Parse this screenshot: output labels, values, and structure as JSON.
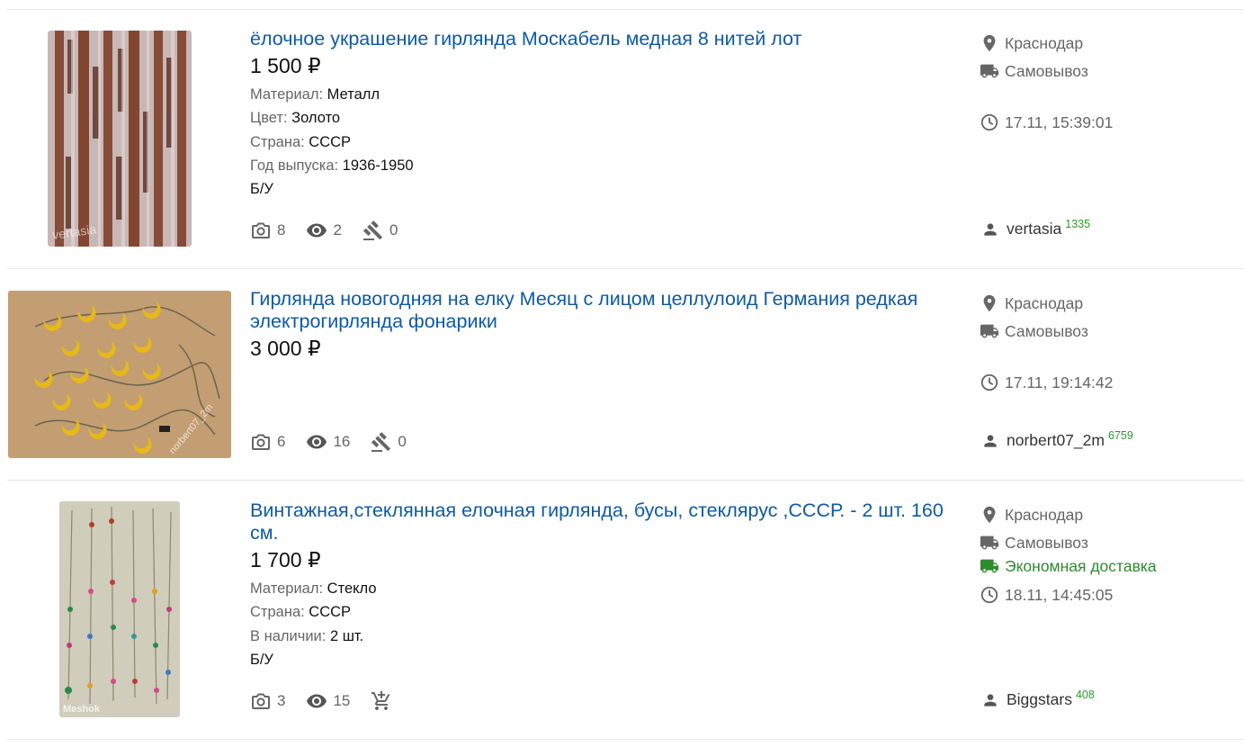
{
  "listings": [
    {
      "title": "ёлочное украшение гирлянда Москабель медная 8 нитей лот",
      "price": "1 500 ₽",
      "attributes": [
        {
          "key": "Материал:",
          "value": "Металл"
        },
        {
          "key": "Цвет:",
          "value": "Золото"
        },
        {
          "key": "Страна:",
          "value": "СССР"
        },
        {
          "key": "Год выпуска:",
          "value": "1936-1950"
        }
      ],
      "condition": "Б/У",
      "photos": "8",
      "views": "2",
      "bids": "0",
      "city": "Краснодар",
      "pickup": "Самовывоз",
      "datetime": "17.11, 15:39:01",
      "seller": "vertasia",
      "seller_rating": "1335"
    },
    {
      "title": "Гирлянда новогодняя на елку Месяц с лицом целлулоид Германия редкая электрогирлянда фонарики",
      "price": "3 000 ₽",
      "photos": "6",
      "views": "16",
      "bids": "0",
      "city": "Краснодар",
      "pickup": "Самовывоз",
      "datetime": "17.11, 19:14:42",
      "seller": "norbert07_2m",
      "seller_rating": "6759"
    },
    {
      "title": "Винтажная,стеклянная елочная гирлянда, бусы, стеклярус ,СССР. - 2 шт. 160 см.",
      "price": "1 700 ₽",
      "attributes": [
        {
          "key": "Материал:",
          "value": "Стекло"
        },
        {
          "key": "Страна:",
          "value": "СССР"
        },
        {
          "key": "В наличии:",
          "value": "2 шт."
        }
      ],
      "condition": "Б/У",
      "photos": "3",
      "views": "15",
      "city": "Краснодар",
      "pickup": "Самовывоз",
      "delivery": "Экономная доставка",
      "datetime": "18.11, 14:45:05",
      "seller": "Biggstars",
      "seller_rating": "408"
    }
  ],
  "colors": {
    "title_link": "#0d5aa7",
    "rating": "#2a9a2a",
    "delivery": "#2e8b2e"
  },
  "icons": [
    "location-pin-icon",
    "truck-icon",
    "clock-icon",
    "camera-icon",
    "eye-icon",
    "gavel-icon",
    "cart-plus-icon",
    "user-icon"
  ],
  "watermarks": [
    "vertasia",
    "norbert07_2m",
    "Meshok"
  ]
}
